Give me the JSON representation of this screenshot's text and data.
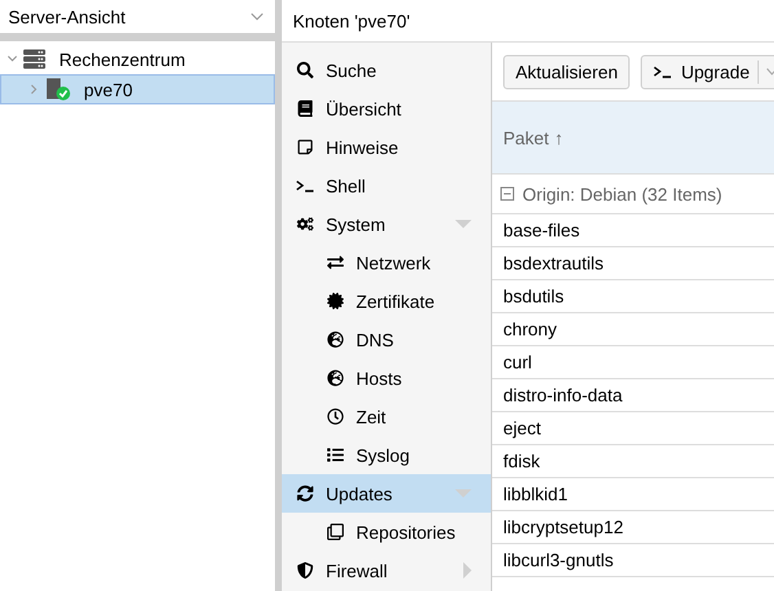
{
  "view_selector": {
    "value": "Server-Ansicht"
  },
  "tree": [
    {
      "label": "Rechenzentrum",
      "expanded": true,
      "selected": false,
      "children": [
        {
          "label": "pve70",
          "expanded": false,
          "selected": true
        }
      ]
    }
  ],
  "panel_title": "Knoten 'pve70'",
  "nav": [
    {
      "label": "Suche",
      "selected": false
    },
    {
      "label": "Übersicht",
      "selected": false
    },
    {
      "label": "Hinweise",
      "selected": false
    },
    {
      "label": "Shell",
      "selected": false
    },
    {
      "label": "System",
      "selected": false,
      "expanded": true,
      "children": [
        {
          "label": "Netzwerk",
          "selected": false
        },
        {
          "label": "Zertifikate",
          "selected": false
        },
        {
          "label": "DNS",
          "selected": false
        },
        {
          "label": "Hosts",
          "selected": false
        },
        {
          "label": "Zeit",
          "selected": false
        },
        {
          "label": "Syslog",
          "selected": false
        }
      ]
    },
    {
      "label": "Updates",
      "selected": true,
      "expanded": true,
      "children": [
        {
          "label": "Repositories",
          "selected": false
        }
      ]
    },
    {
      "label": "Firewall",
      "selected": false,
      "expanded": false
    }
  ],
  "toolbar": {
    "refresh": "Aktualisieren",
    "upgrade": "Upgrade"
  },
  "table": {
    "columns": [
      {
        "label": "Paket",
        "sort": "↑"
      }
    ],
    "group": "Origin: Debian (32 Items)",
    "rows": [
      "base-files",
      "bsdextrautils",
      "bsdutils",
      "chrony",
      "curl",
      "distro-info-data",
      "eject",
      "fdisk",
      "libblkid1",
      "libcryptsetup12",
      "libcurl3-gnutls"
    ]
  }
}
